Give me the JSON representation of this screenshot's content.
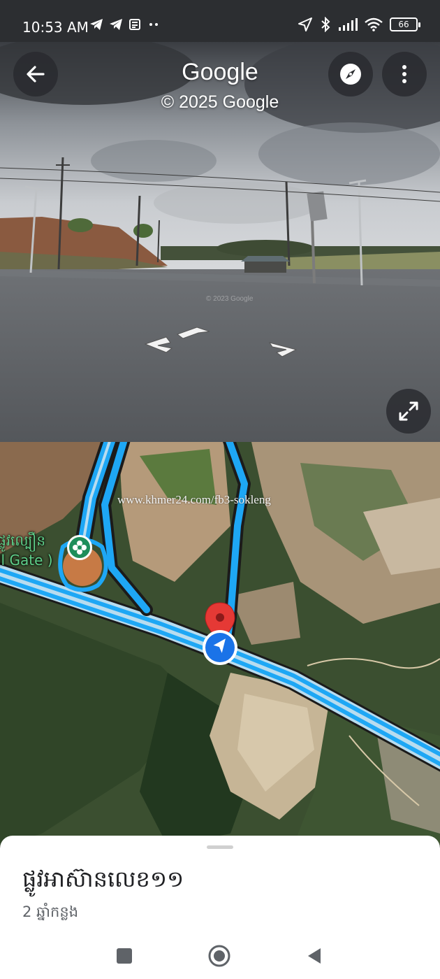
{
  "status_bar": {
    "time": "10:53 AM",
    "left_icons": [
      "telegram-icon",
      "telegram-icon",
      "news-icon",
      "more-dots-icon"
    ],
    "right_icons": [
      "location-arrow-icon",
      "bluetooth-icon",
      "signal-icon",
      "wifi-icon",
      "battery-icon"
    ],
    "battery_level": "66"
  },
  "street_view": {
    "title": "Google",
    "copyright": "© 2025 Google",
    "image_watermark": "© 2023 Google",
    "buttons": {
      "back": "back-arrow-icon",
      "compass": "compass-icon",
      "more": "more-vertical-icon",
      "expand": "expand-icon"
    }
  },
  "map": {
    "watermark": "www.khmer24.com/fb3-sokleng",
    "poi_label_line1": "ផ្លូវល្បឿន",
    "poi_label_line2": "ll Gate )",
    "poi_icon": "flower-poi-icon",
    "current_location_icon": "navigation-arrow-icon",
    "pin_icon": "red-pin-icon"
  },
  "sheet": {
    "title": "ផ្លូវអាស៊ានលេខ១១",
    "subtitle": "2 ឆ្នាំកន្លង"
  },
  "nav_bar": [
    "recent-apps-icon",
    "home-icon",
    "back-triangle-icon"
  ],
  "colors": {
    "road_blue": "#1ea7f5",
    "pin_red": "#e53935",
    "location_blue": "#1a73e8"
  }
}
